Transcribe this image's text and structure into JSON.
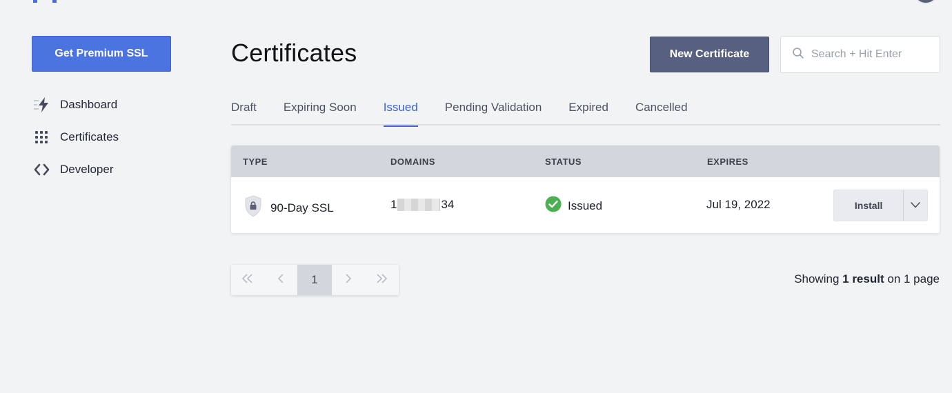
{
  "sidebar": {
    "premium_label": "Get Premium SSL",
    "items": [
      {
        "label": "Dashboard",
        "icon": "bolt-icon"
      },
      {
        "label": "Certificates",
        "icon": "grid-icon"
      },
      {
        "label": "Developer",
        "icon": "code-icon"
      }
    ]
  },
  "header": {
    "title": "Certificates",
    "new_button": "New Certificate",
    "search_placeholder": "Search + Hit Enter"
  },
  "tabs": [
    {
      "label": "Draft"
    },
    {
      "label": "Expiring Soon"
    },
    {
      "label": "Issued",
      "active": true
    },
    {
      "label": "Pending Validation"
    },
    {
      "label": "Expired"
    },
    {
      "label": "Cancelled"
    }
  ],
  "table": {
    "headers": [
      "TYPE",
      "DOMAINS",
      "STATUS",
      "EXPIRES"
    ],
    "rows": [
      {
        "type": "90-Day SSL",
        "domain_start": "1",
        "domain_end": "34",
        "status": "Issued",
        "expires": "Jul 19, 2022",
        "action": "Install"
      }
    ]
  },
  "pagination": {
    "current_page": "1",
    "result_prefix": "Showing",
    "result_count": "1 result",
    "result_suffix": "on 1 page"
  },
  "colors": {
    "primary": "#4c74e0",
    "secondary": "#576080",
    "active_tab": "#3b63d3",
    "success": "#4cb050"
  }
}
